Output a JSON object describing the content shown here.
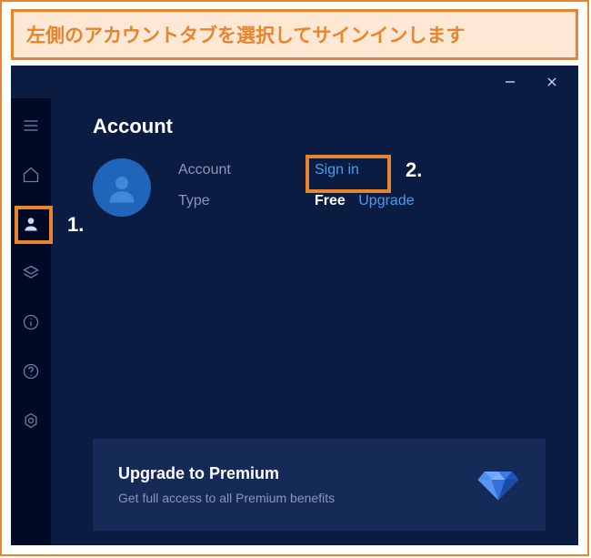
{
  "instruction": "左側のアカウントタブを選択してサインインします",
  "callouts": {
    "one": "1.",
    "two": "2."
  },
  "page": {
    "title": "Account"
  },
  "account": {
    "label_account": "Account",
    "signin": "Sign in",
    "label_type": "Type",
    "type_value": "Free",
    "upgrade": "Upgrade"
  },
  "premium": {
    "title": "Upgrade to Premium",
    "subtitle": "Get full access to all Premium benefits"
  },
  "colors": {
    "accent_orange": "#e8852c",
    "app_bg": "#0b1c42",
    "sidebar_bg": "#000a24",
    "link_blue": "#42a0e8"
  }
}
